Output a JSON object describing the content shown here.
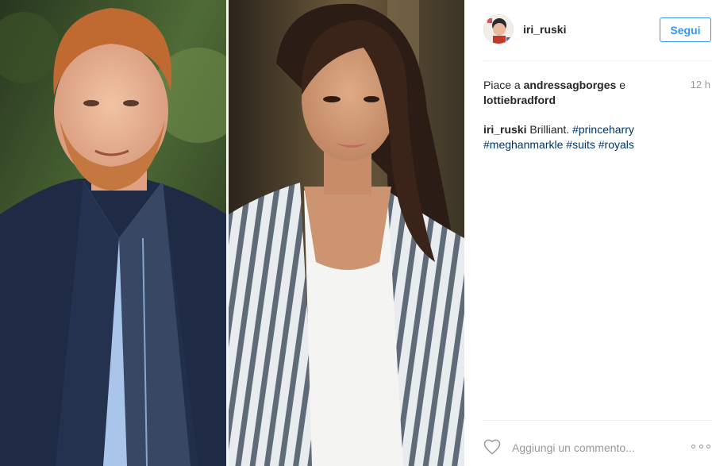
{
  "post": {
    "username": "iri_ruski",
    "follow_label": "Segui",
    "likes": {
      "prefix": "Piace a",
      "user1": "andressagborges",
      "conjunction": "e",
      "user2": "lottiebradford"
    },
    "time": "12 h",
    "caption": {
      "username": "iri_ruski",
      "text": "Brilliant.",
      "hashtags": [
        "#princeharry",
        "#meghanmarkle",
        "#suits",
        "#royals"
      ]
    },
    "comment_placeholder": "Aggiungi un commento..."
  },
  "icons": {
    "like": "heart-icon",
    "options": "more-options-icon"
  },
  "colors": {
    "link_blue": "#3897f0",
    "hashtag": "#003569",
    "muted": "#999999",
    "text": "#262626"
  }
}
